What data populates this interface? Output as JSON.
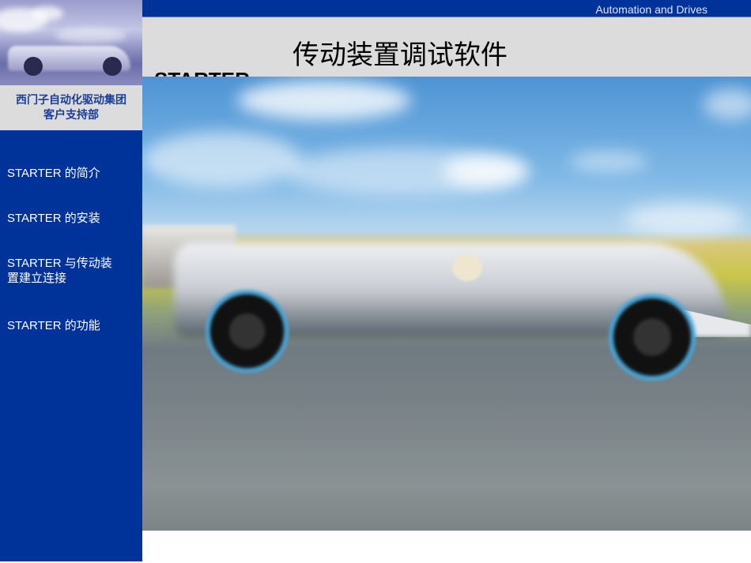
{
  "header": {
    "brand": "Automation and Drives",
    "title": "传动装置调试软件",
    "subtitle": "STARTER"
  },
  "sidebar": {
    "company_line1": "西门子自动化驱动集团",
    "company_line2": "客户支持部",
    "items": [
      {
        "label": "STARTER  的简介"
      },
      {
        "label": "STARTER  的安装"
      },
      {
        "label": "STARTER  与传动装置建立连接"
      },
      {
        "label": "STARTER  的功能"
      }
    ]
  },
  "colors": {
    "brand_blue": "#003399",
    "header_gray": "#dcdcdc",
    "company_text": "#1b3d9a"
  },
  "images": {
    "thumbnail": "race-car-thumbnail",
    "main": "race-car-photo"
  }
}
